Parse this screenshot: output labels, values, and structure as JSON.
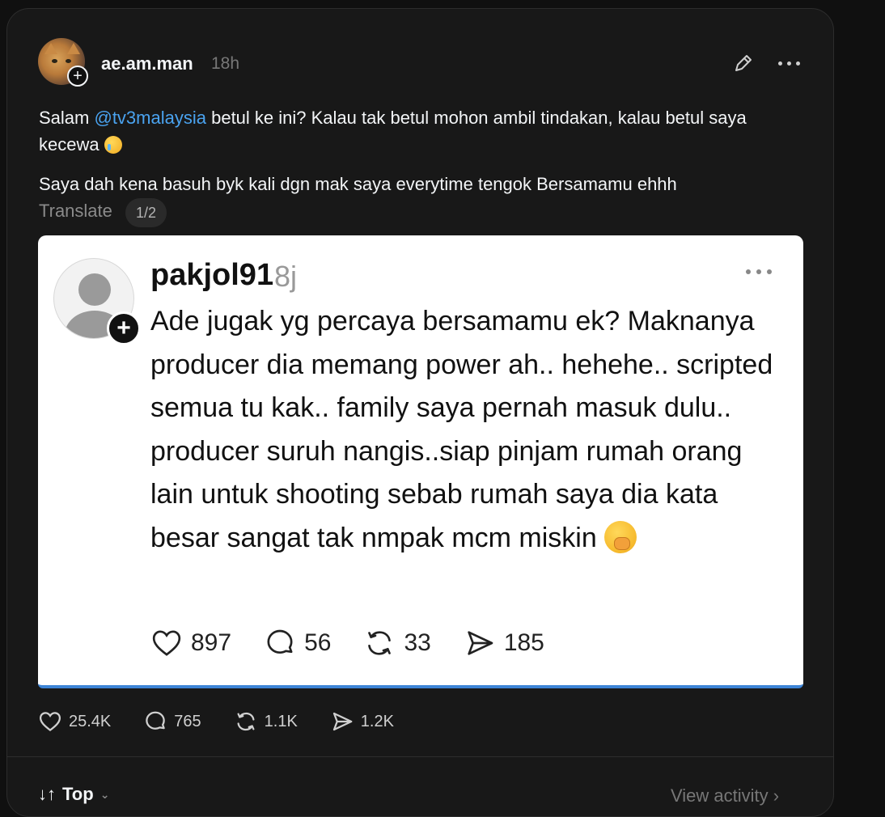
{
  "post": {
    "author": "ae.am.man",
    "time": "18h",
    "text_prefix": "Salam ",
    "mention": "@tv3malaysia",
    "text_suffix": " betul ke ini? Kalau tak betul mohon ambil tindakan, kalau betul saya kecewa ",
    "text2": "Saya dah kena basuh byk kali dgn mak saya everytime tengok Bersamamu ehhh",
    "translate_label": "Translate",
    "pager": "1/2",
    "follow_symbol": "+"
  },
  "embed": {
    "author": "pakjol91",
    "time": "8j",
    "text": "Ade jugak yg percaya bersamamu ek? Maknanya producer dia memang power ah.. hehehe.. scripted semua tu kak.. family saya pernah masuk dulu.. producer suruh nangis..siap pinjam rumah orang lain untuk shooting sebab rumah saya dia kata besar sangat tak nmpak mcm miskin ",
    "follow_symbol": "+",
    "actions": {
      "likes": "897",
      "comments": "56",
      "reposts": "33",
      "shares": "185"
    }
  },
  "actions": {
    "likes": "25.4K",
    "comments": "765",
    "reposts": "1.1K",
    "shares": "1.2K"
  },
  "footer": {
    "sort_label": "Top",
    "view_activity": "View activity ›"
  },
  "icons": {
    "edit": "edit-icon",
    "more": "more-icon",
    "heart": "heart-icon",
    "comment": "comment-icon",
    "repost": "repost-icon",
    "share": "share-icon",
    "sort": "sort-icon",
    "chevron": "chevron-down-icon"
  },
  "colors": {
    "background": "#101010",
    "card": "#181818",
    "mention": "#4aa3f0",
    "embed_border": "#3d84d6"
  }
}
